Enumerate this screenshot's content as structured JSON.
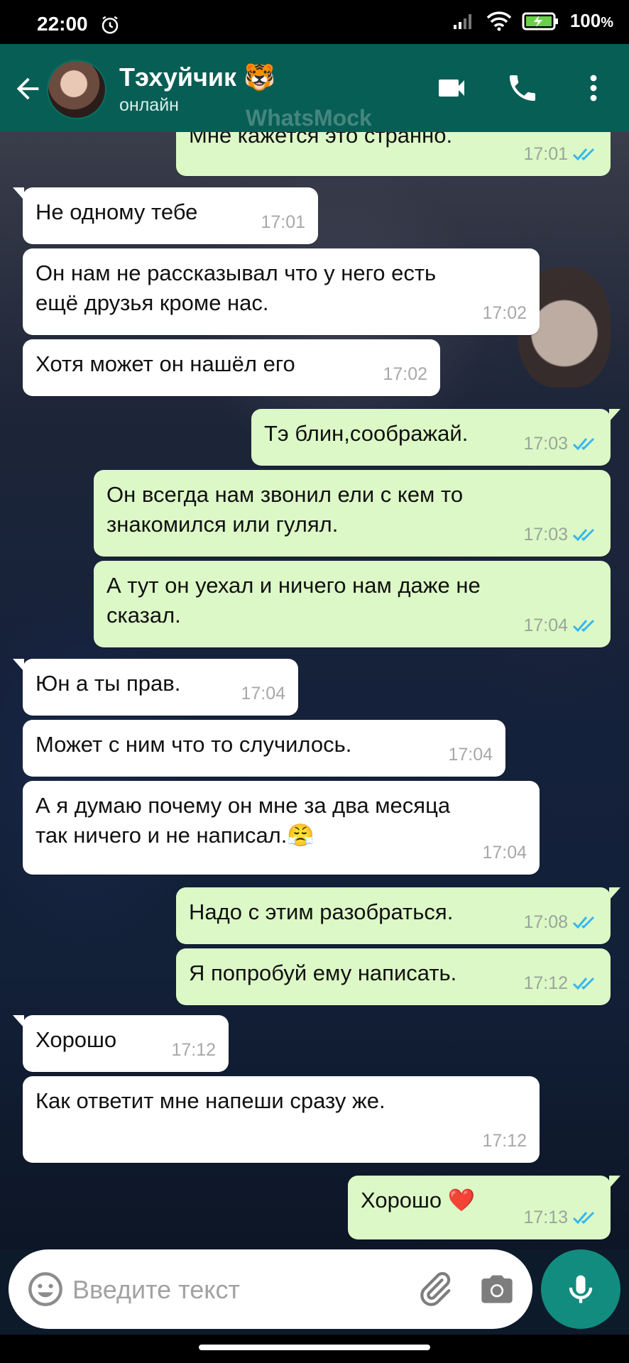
{
  "status_bar": {
    "time": "22:00",
    "battery": "100",
    "battery_unit": "%"
  },
  "header": {
    "contact_name": "Тэхуйчик 🐯",
    "contact_status": "онлайн",
    "watermark": "WhatsMock"
  },
  "messages": [
    {
      "dir": "out",
      "text": "Мне кажется это странно.",
      "time": "17:01",
      "read": true
    },
    {
      "dir": "in",
      "text": "Не одному тебе",
      "time": "17:01"
    },
    {
      "dir": "in",
      "text": "Он нам не рассказывал что у него есть\nещё друзья кроме нас.",
      "time": "17:02"
    },
    {
      "dir": "in",
      "text": "Хотя может он нашёл его",
      "time": "17:02"
    },
    {
      "dir": "out",
      "text": "Тэ блин,соображай.",
      "time": "17:03",
      "read": true
    },
    {
      "dir": "out",
      "text": "Он всегда нам звонил ели с кем то\nзнакомился или гулял.",
      "time": "17:03",
      "read": true
    },
    {
      "dir": "out",
      "text": "А тут он уехал и ничего нам даже не\nсказал.",
      "time": "17:04",
      "read": true
    },
    {
      "dir": "in",
      "text": "Юн а ты прав.",
      "time": "17:04"
    },
    {
      "dir": "in",
      "text": "Может с ним что то случилось.",
      "time": "17:04"
    },
    {
      "dir": "in",
      "text": "А я думаю почему он мне за два месяца\nтак ничего и не написал.😤",
      "time": "17:04"
    },
    {
      "dir": "out",
      "text": "Надо с этим разобраться.",
      "time": "17:08",
      "read": true
    },
    {
      "dir": "out",
      "text": "Я попробуй ему написать.",
      "time": "17:12",
      "read": true
    },
    {
      "dir": "in",
      "text": "Хорошо",
      "time": "17:12"
    },
    {
      "dir": "in",
      "text": "Как ответит мне напеши сразу же.",
      "time": "17:12"
    },
    {
      "dir": "out",
      "text": "Хорошо ❤️",
      "time": "17:13",
      "read": true
    }
  ],
  "input": {
    "placeholder": "Введите текст",
    "value": ""
  },
  "colors": {
    "header": "#075e54",
    "outgoing_bubble": "#dcf8c6",
    "incoming_bubble": "#ffffff",
    "read_ticks": "#34b7f1",
    "fab": "#128c7e"
  },
  "icons": [
    "back-arrow-icon",
    "video-call-icon",
    "voice-call-icon",
    "more-options-icon",
    "emoji-icon",
    "attach-clip-icon",
    "camera-icon",
    "microphone-icon"
  ]
}
